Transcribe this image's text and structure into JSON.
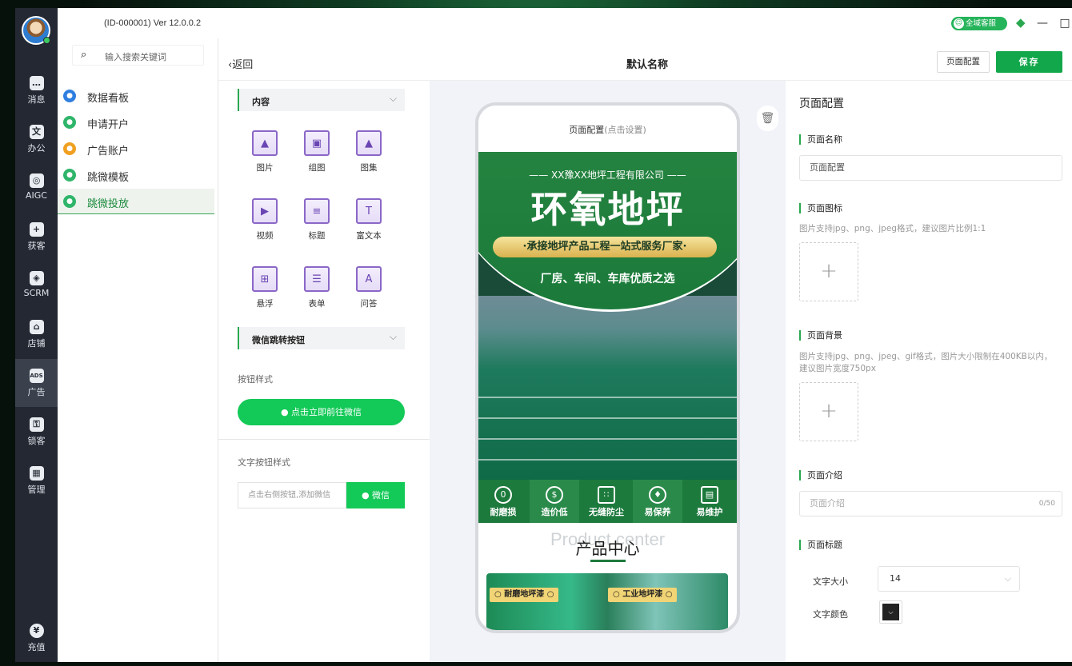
{
  "app": {
    "id_version": "(ID-000001)  Ver 12.0.0.2"
  },
  "rail": {
    "items": [
      {
        "label": "消息",
        "icon": "chat-icon"
      },
      {
        "label": "办公",
        "icon": "office-icon"
      },
      {
        "label": "AIGC",
        "icon": "aigc-icon"
      },
      {
        "label": "获客",
        "icon": "acquire-user-icon"
      },
      {
        "label": "SCRM",
        "icon": "scrm-icon"
      },
      {
        "label": "店铺",
        "icon": "store-icon"
      },
      {
        "label": "广告",
        "icon": "ads-icon"
      },
      {
        "label": "锁客",
        "icon": "lock-user-icon"
      },
      {
        "label": "管理",
        "icon": "grid-icon"
      },
      {
        "label": "充值",
        "icon": "yen-icon"
      }
    ]
  },
  "titlebar": {
    "service_label": "全域客服"
  },
  "menu": {
    "search_placeholder": "输入搜索关键词",
    "items": [
      {
        "label": "数据看板",
        "color": "#2f7fe0"
      },
      {
        "label": "申请开户",
        "color": "#2fb56a"
      },
      {
        "label": "广告账户",
        "color": "#f0a020"
      },
      {
        "label": "跳微模板",
        "color": "#2fb56a"
      },
      {
        "label": "跳微投放",
        "color": "#2fb56a"
      }
    ],
    "active_index": 4
  },
  "header": {
    "back": "返回",
    "title": "默认名称",
    "page_config_btn": "页面配置",
    "save_btn": "保存"
  },
  "components": {
    "content_section": "内容",
    "tiles": [
      {
        "label": "图片",
        "glyph": "▲"
      },
      {
        "label": "组图",
        "glyph": "▣"
      },
      {
        "label": "图集",
        "glyph": "▲"
      },
      {
        "label": "视频",
        "glyph": "▶"
      },
      {
        "label": "标题",
        "glyph": "≡"
      },
      {
        "label": "富文本",
        "glyph": "T"
      },
      {
        "label": "悬浮",
        "glyph": "⊞"
      },
      {
        "label": "表单",
        "glyph": "☰"
      },
      {
        "label": "问答",
        "glyph": "A"
      }
    ],
    "wechat_section": "微信跳转按钮",
    "button_style_label": "按钮样式",
    "green_button": "点击立即前往微信",
    "text_button_style_label": "文字按钮样式",
    "text_input_placeholder": "点击右侧按钮,添加微信",
    "text_button_label": "微信"
  },
  "preview": {
    "top_label": "页面配置",
    "top_hint": "(点击设置)",
    "company": "—— XX豫XX地坪工程有限公司 ——",
    "headline": "环氧地坪",
    "slogan": "·承接地坪产品工程一站式服务厂家·",
    "subline": "厂房、车间、车库优质之选",
    "features": [
      {
        "label": "耐磨损",
        "glyph": "0"
      },
      {
        "label": "造价低",
        "glyph": "$"
      },
      {
        "label": "无缝防尘",
        "glyph": "∷"
      },
      {
        "label": "易保养",
        "glyph": "♦"
      },
      {
        "label": "易维护",
        "glyph": "▤"
      }
    ],
    "product_ghost": "Product center",
    "product_title": "产品中心",
    "product_tags": [
      "○ 耐磨地坪漆 ○",
      "○ 工业地坪漆 ○"
    ]
  },
  "config": {
    "title": "页面配置",
    "name_label": "页面名称",
    "name_value": "页面配置",
    "icon_label": "页面图标",
    "icon_hint": "图片支持jpg、png、jpeg格式，建议图片比例1:1",
    "bg_label": "页面背景",
    "bg_hint": "图片支持jpg、png、jpeg、gif格式，图片大小限制在400KB以内，建议图片宽度750px",
    "intro_label": "页面介绍",
    "intro_placeholder": "页面介绍",
    "intro_count": "0/50",
    "page_title_label": "页面标题",
    "font_size_label": "文字大小",
    "font_size_value": "14",
    "font_color_label": "文字颜色"
  }
}
